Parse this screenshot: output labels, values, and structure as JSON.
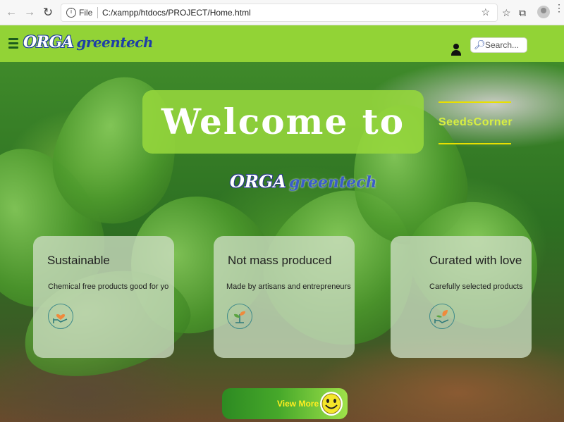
{
  "browser": {
    "address_file_label": "File",
    "url": "C:/xampp/htdocs/PROJECT/Home.html"
  },
  "header": {
    "logo_orga": "ORGA",
    "logo_greentech": "greentech",
    "search_placeholder": "Search..."
  },
  "hero": {
    "welcome_text": "Welcome to",
    "seeds_label": "SeedsCorner",
    "logo_orga": "ORGA",
    "logo_greentech": "greentech"
  },
  "cards": [
    {
      "title": "Sustainable",
      "description": "Chemical free products good for yo",
      "icon": "heart-in-hand-icon"
    },
    {
      "title": "Not mass produced",
      "description": "Made by artisans and entrepreneurs",
      "icon": "sprout-icon"
    },
    {
      "title": "Curated with love",
      "description": "Carefully selected products",
      "icon": "leaf-in-hand-icon"
    }
  ],
  "view_more": {
    "label": "View More",
    "icon": "smiley-icon"
  },
  "colors": {
    "header_green": "#92d336",
    "welcome_box": "#96d73c",
    "seeds_accent": "#e8e000",
    "button_text": "#ffee20"
  }
}
